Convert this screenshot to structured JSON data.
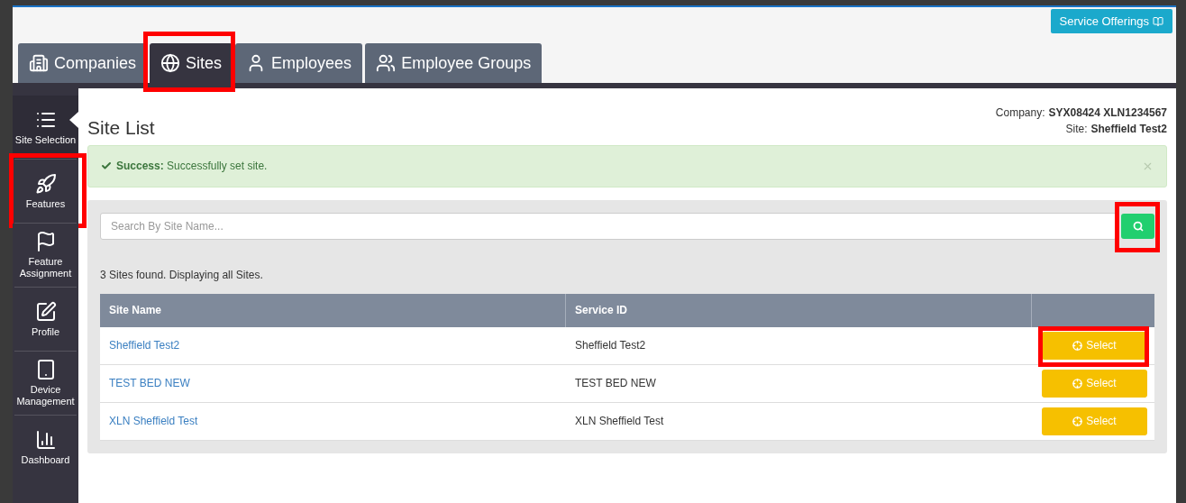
{
  "header": {
    "service_button": "Service Offerings"
  },
  "tabs": [
    {
      "label": "Companies",
      "selected": false,
      "highlighted": false
    },
    {
      "label": "Sites",
      "selected": true,
      "highlighted": true
    },
    {
      "label": "Employees",
      "selected": false,
      "highlighted": false
    },
    {
      "label": "Employee Groups",
      "selected": false,
      "highlighted": false
    }
  ],
  "sidebar": {
    "items": [
      {
        "label": "Site Selection",
        "selected": true,
        "highlighted": false
      },
      {
        "label": "Features",
        "selected": false,
        "highlighted": true
      },
      {
        "label": "Feature Assignment",
        "selected": false,
        "highlighted": false
      },
      {
        "label": "Profile",
        "selected": false,
        "highlighted": false
      },
      {
        "label": "Device Management",
        "selected": false,
        "highlighted": false
      },
      {
        "label": "Dashboard",
        "selected": false,
        "highlighted": false
      }
    ]
  },
  "page": {
    "title": "Site List",
    "company_label": "Company:",
    "company": "SYX08424 XLN1234567",
    "site_label": "Site:",
    "site": "Sheffield Test2"
  },
  "alert": {
    "text": "**Success:** Successfully set site."
  },
  "search": {
    "placeholder": "Search By Site Name...",
    "button_highlighted": true
  },
  "result_text": "3 Sites found. Displaying all Sites.",
  "table": {
    "columns": [
      "Site Name",
      "Service ID"
    ],
    "rows": [
      {
        "site_name": "Sheffield Test2",
        "service_id": "Sheffield Test2",
        "action": "Select",
        "highlighted": true
      },
      {
        "site_name": "TEST BED NEW",
        "service_id": "TEST BED NEW",
        "action": "Select",
        "highlighted": false
      },
      {
        "site_name": "XLN Sheffield Test",
        "service_id": "XLN Sheffield Test",
        "action": "Select",
        "highlighted": false
      }
    ]
  }
}
